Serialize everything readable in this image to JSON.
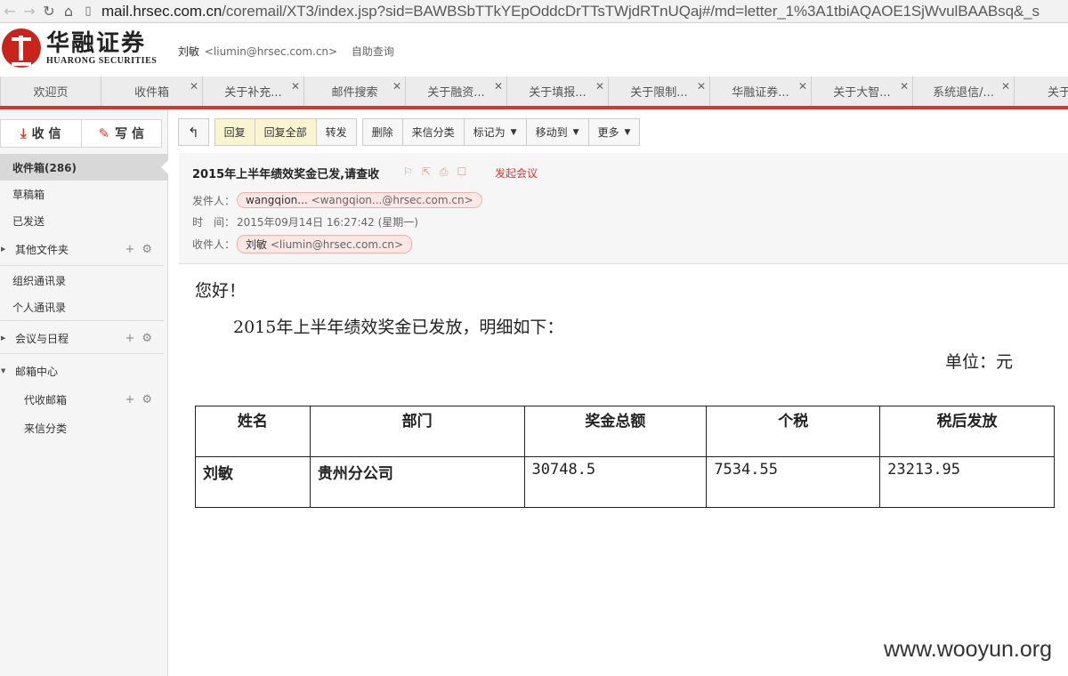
{
  "browser": {
    "url_host": "mail.hrsec.com.cn",
    "url_rest": "/coremail/XT3/index.jsp?sid=BAWBSbTTkYEpOddcDrTTsTWjdRTnUQaj#/md=letter_1%3A1tbiAQAOE1SjWvulBAABsq&_s"
  },
  "brand": {
    "name_cn": "华融证券",
    "name_en": "HUARONG SECURITIES",
    "color": "#c8241c"
  },
  "user": {
    "name": "刘敏",
    "email": "<liumin@hrsec.com.cn>",
    "self_query": "自助查询"
  },
  "tabs": [
    {
      "label": "欢迎页",
      "closable": false
    },
    {
      "label": "收件箱",
      "closable": true
    },
    {
      "label": "关于补充...",
      "closable": true
    },
    {
      "label": "邮件搜索",
      "closable": true
    },
    {
      "label": "关于融资...",
      "closable": true
    },
    {
      "label": "关于填报...",
      "closable": true
    },
    {
      "label": "关于限制...",
      "closable": true
    },
    {
      "label": "华融证券...",
      "closable": true
    },
    {
      "label": "关于大智...",
      "closable": true
    },
    {
      "label": "系统退信/...",
      "closable": true
    },
    {
      "label": "关于金"
    }
  ],
  "sidebar": {
    "receive": "收 信",
    "compose": "写 信",
    "folders": {
      "inbox": "收件箱(286)",
      "drafts": "草稿箱",
      "sent": "已发送",
      "other": "其他文件夹",
      "org_contacts": "组织通讯录",
      "personal_contacts": "个人通讯录",
      "calendar": "会议与日程",
      "mail_center": "邮箱中心",
      "fetch_mail": "代收邮箱",
      "classify": "来信分类"
    }
  },
  "toolbar": {
    "reply": "回复",
    "reply_all": "回复全部",
    "forward": "转发",
    "delete": "删除",
    "classify": "来信分类",
    "mark_as": "标记为",
    "move_to": "移动到",
    "more": "更多"
  },
  "mail": {
    "subject": "2015年上半年绩效奖金已发,请查收",
    "start_meeting": "发起会议",
    "from_label": "发件人：",
    "from_name": "wangqion...",
    "from_addr": "<wangqion...@hrsec.com.cn>",
    "time_label": "时　间：",
    "time_value": "2015年09月14日 16:27:42 (星期一)",
    "to_label": "收件人：",
    "to_name": "刘敏",
    "to_addr": "<liumin@hrsec.com.cn>",
    "greeting": "您好！",
    "paragraph": "2015年上半年绩效奖金已发放，明细如下：",
    "unit": "单位：元",
    "table": {
      "headers": [
        "姓名",
        "部门",
        "奖金总额",
        "个税",
        "税后发放"
      ],
      "row": [
        "刘敏",
        "贵州分公司",
        "30748.5",
        "7534.55",
        "23213.95"
      ]
    }
  },
  "watermark": "www.wooyun.org"
}
